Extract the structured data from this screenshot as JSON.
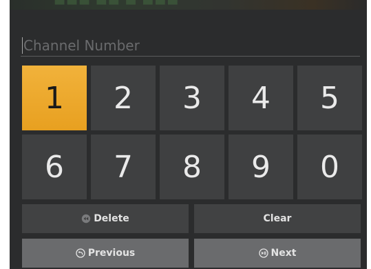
{
  "input": {
    "placeholder": "Channel Number",
    "value": ""
  },
  "keypad": {
    "selected": "1",
    "row1": [
      "1",
      "2",
      "3",
      "4",
      "5"
    ],
    "row2": [
      "6",
      "7",
      "8",
      "9",
      "0"
    ]
  },
  "actions": {
    "delete_label": "Delete",
    "clear_label": "Clear",
    "previous_label": "Previous",
    "next_label": "Next"
  },
  "icons": {
    "delete": "rewind-circle-icon",
    "previous": "back-circle-icon",
    "next": "play-pause-circle-icon"
  },
  "colors": {
    "background": "#2b2c2d",
    "key": "#3f4041",
    "selected_key": "#f0ab2c",
    "action": "#414243",
    "action_light": "#6a6b6d",
    "text": "#eaeaea"
  }
}
